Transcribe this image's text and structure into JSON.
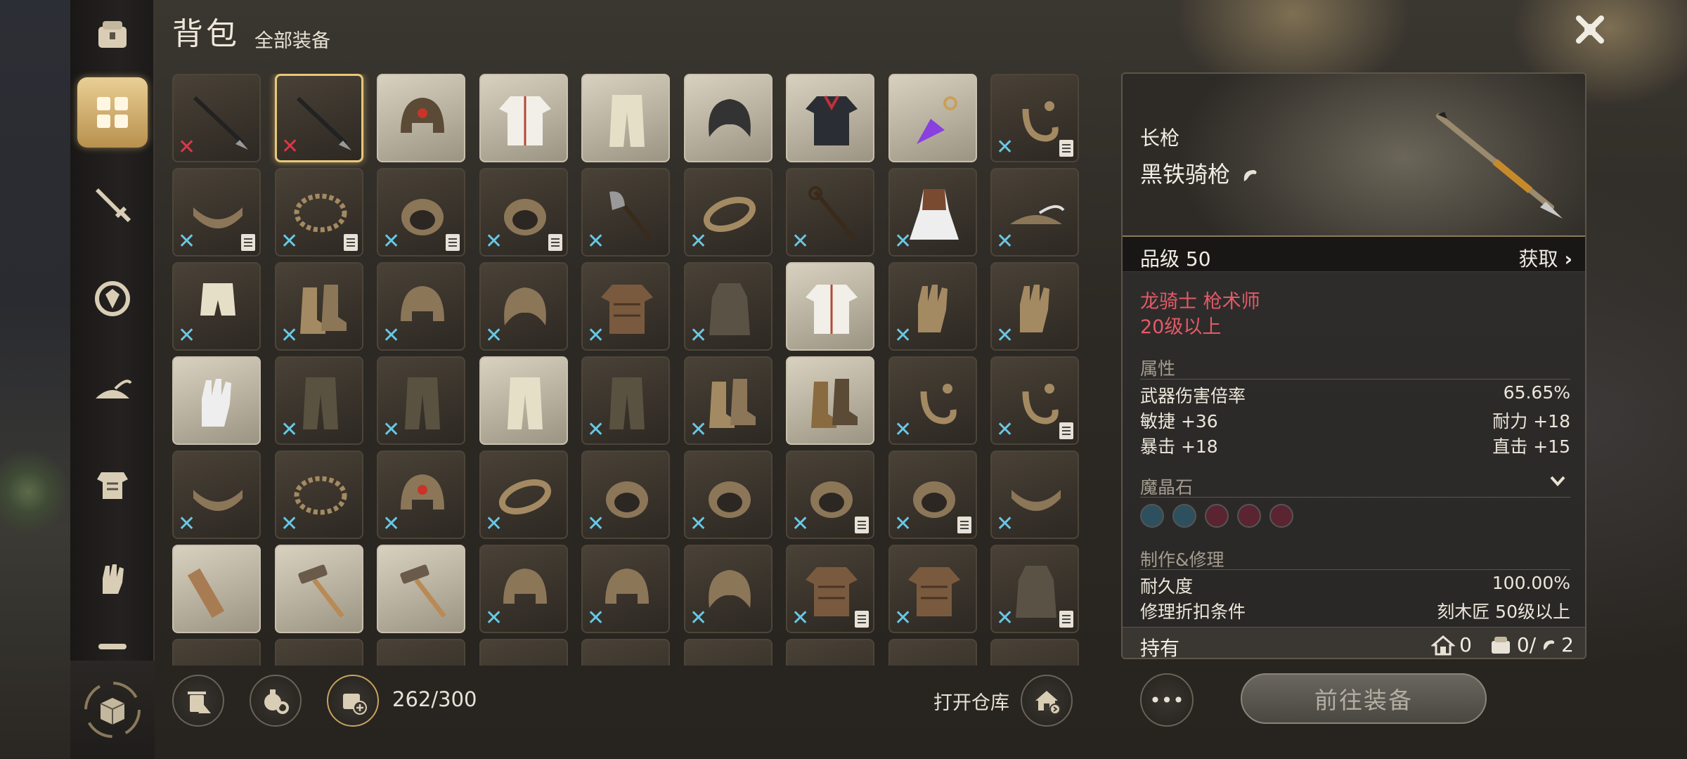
{
  "header": {
    "title": "背包",
    "subtitle": "全部装备"
  },
  "sidebar": {
    "items": [
      {
        "name": "bag-chest-icon"
      },
      {
        "name": "grid-all-icon",
        "active": true
      },
      {
        "name": "sword-icon"
      },
      {
        "name": "shield-icon"
      },
      {
        "name": "hat-icon"
      },
      {
        "name": "armor-icon"
      },
      {
        "name": "gauntlet-icon"
      }
    ]
  },
  "inventory": {
    "capacity": "262/300",
    "slots": [
      {
        "icon": "spear-icon",
        "mark": "red"
      },
      {
        "icon": "spear-icon",
        "mark": "red",
        "selected": true
      },
      {
        "icon": "helmet-gem-icon",
        "light": true
      },
      {
        "icon": "white-robe-icon",
        "light": true
      },
      {
        "icon": "cloth-pants-icon",
        "light": true
      },
      {
        "icon": "cap-icon",
        "light": true
      },
      {
        "icon": "dark-coat-icon",
        "light": true
      },
      {
        "icon": "purple-gem-icon",
        "light": true
      },
      {
        "icon": "earring-icon",
        "mark": "cyan",
        "note": true
      },
      {
        "icon": "belt-icon",
        "mark": "cyan",
        "note": true
      },
      {
        "icon": "necklace-icon",
        "mark": "cyan",
        "note": true
      },
      {
        "icon": "ring-icon",
        "mark": "cyan",
        "note": true
      },
      {
        "icon": "ring-icon",
        "mark": "cyan",
        "note": true
      },
      {
        "icon": "axe-icon",
        "mark": "cyan"
      },
      {
        "icon": "bracelet-icon",
        "mark": "cyan"
      },
      {
        "icon": "staff-icon",
        "mark": "cyan"
      },
      {
        "icon": "dress-icon",
        "mark": "cyan"
      },
      {
        "icon": "feather-hat-icon",
        "mark": "cyan"
      },
      {
        "icon": "shorts-icon",
        "mark": "cyan"
      },
      {
        "icon": "boots-icon",
        "mark": "cyan"
      },
      {
        "icon": "helmet-icon",
        "mark": "cyan"
      },
      {
        "icon": "hood-icon",
        "mark": "cyan"
      },
      {
        "icon": "leather-armor-icon",
        "mark": "cyan"
      },
      {
        "icon": "robe-icon",
        "mark": "cyan"
      },
      {
        "icon": "tunic-icon",
        "light": true
      },
      {
        "icon": "gloves-icon",
        "mark": "cyan"
      },
      {
        "icon": "gloves-icon",
        "mark": "cyan"
      },
      {
        "icon": "gloves-icon",
        "light": true
      },
      {
        "icon": "pants-icon",
        "mark": "cyan"
      },
      {
        "icon": "pants-icon",
        "mark": "cyan"
      },
      {
        "icon": "cloth-pants-icon",
        "light": true
      },
      {
        "icon": "pants-icon",
        "mark": "cyan"
      },
      {
        "icon": "boots-icon",
        "mark": "cyan"
      },
      {
        "icon": "boots-icon",
        "light": true
      },
      {
        "icon": "earring-icon",
        "mark": "cyan"
      },
      {
        "icon": "earring-icon",
        "mark": "cyan",
        "note": true
      },
      {
        "icon": "belt-icon",
        "mark": "cyan"
      },
      {
        "icon": "necklace-icon",
        "mark": "cyan"
      },
      {
        "icon": "helmet-gem-icon",
        "mark": "cyan"
      },
      {
        "icon": "bracelet-icon",
        "mark": "cyan"
      },
      {
        "icon": "ring-icon",
        "mark": "cyan"
      },
      {
        "icon": "ring-icon",
        "mark": "cyan"
      },
      {
        "icon": "ring-icon",
        "mark": "cyan",
        "note": true
      },
      {
        "icon": "ring-icon",
        "mark": "cyan",
        "note": true
      },
      {
        "icon": "belt-icon",
        "mark": "cyan"
      },
      {
        "icon": "ruler-icon",
        "light": true
      },
      {
        "icon": "hammer-icon",
        "light": true
      },
      {
        "icon": "hammer-icon",
        "light": true
      },
      {
        "icon": "helmet-icon",
        "mark": "cyan"
      },
      {
        "icon": "helmet-icon",
        "mark": "cyan"
      },
      {
        "icon": "hood-icon",
        "mark": "cyan"
      },
      {
        "icon": "leather-armor-icon",
        "mark": "cyan",
        "note": true
      },
      {
        "icon": "leather-armor-icon",
        "mark": "cyan"
      },
      {
        "icon": "robe-icon",
        "mark": "cyan",
        "note": true
      },
      {
        "icon": "misc-icon"
      },
      {
        "icon": "misc-icon"
      },
      {
        "icon": "misc-icon"
      },
      {
        "icon": "misc-icon"
      },
      {
        "icon": "misc-icon"
      },
      {
        "icon": "misc-icon"
      },
      {
        "icon": "misc-icon"
      },
      {
        "icon": "misc-icon"
      },
      {
        "icon": "misc-icon"
      }
    ]
  },
  "bottom": {
    "warehouse_label": "打开仓库",
    "more_label": "•••",
    "equip_label": "前往装备"
  },
  "detail": {
    "item_type": "长枪",
    "item_name": "黑铁骑枪",
    "grade": "品级 50",
    "obtain": "获取",
    "requirement_class": "龙骑士  枪术师",
    "requirement_level": "20级以上",
    "attr_title": "属性",
    "attrs": {
      "damage_label": "武器伤害倍率",
      "damage_value": "65.65%",
      "agi": "敏捷  +36",
      "sta": "耐力  +18",
      "crit": "暴击  +18",
      "direct": "直击  +15"
    },
    "gem_title": "魔晶石",
    "gems": [
      "#2e4f5e",
      "#2e4f5e",
      "#5a2530",
      "#5a2530",
      "#5a2530"
    ],
    "craft_title": "制作&修理",
    "durability_label": "耐久度",
    "durability_value": "100.00%",
    "repair_label": "修理折扣条件",
    "repair_value": "刻木匠 50级以上",
    "own_label": "持有",
    "own_home": "0",
    "own_bag": "0/",
    "own_total": "2"
  },
  "colors": {
    "accent_gold": "#e8c877",
    "req_red": "#e35a68",
    "cyan_mark": "#67c8e6",
    "red_mark": "#e0354a"
  }
}
